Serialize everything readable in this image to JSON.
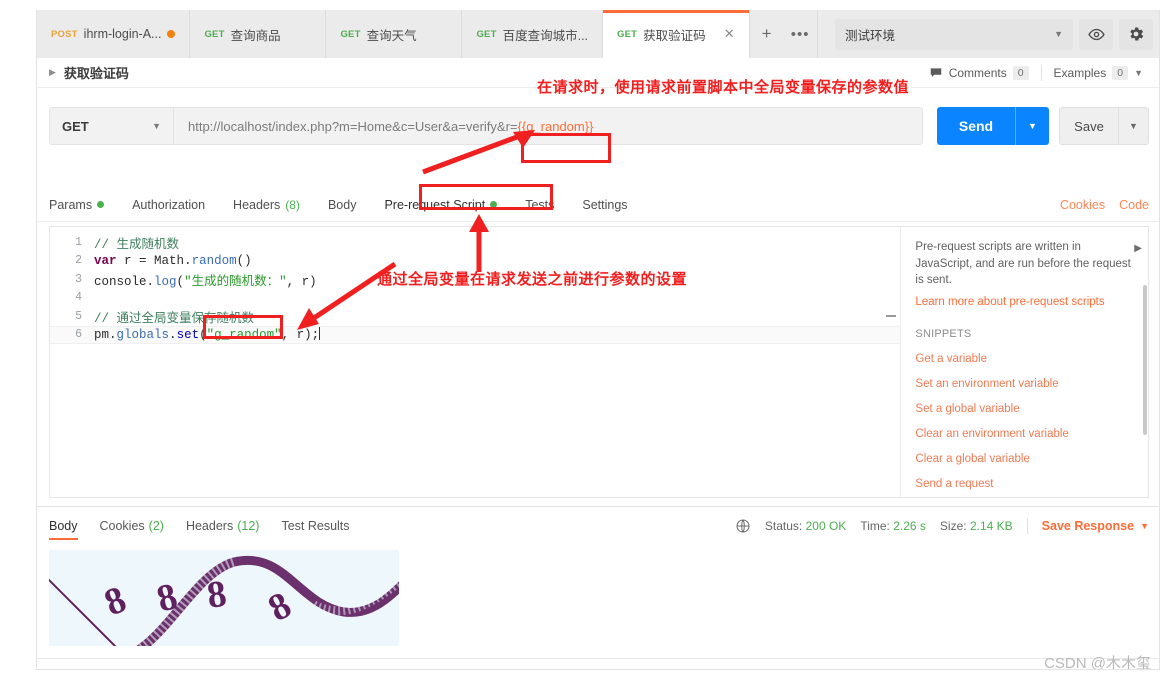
{
  "tabbar": {
    "tabs": [
      {
        "method": "POST",
        "method_class": "post",
        "label": "ihrm-login-A...",
        "unsaved": true,
        "active": false
      },
      {
        "method": "GET",
        "method_class": "get",
        "label": "查询商品",
        "unsaved": false,
        "active": false
      },
      {
        "method": "GET",
        "method_class": "get",
        "label": "查询天气",
        "unsaved": false,
        "active": false
      },
      {
        "method": "GET",
        "method_class": "get",
        "label": "百度查询城市...",
        "unsaved": false,
        "active": false
      },
      {
        "method": "GET",
        "method_class": "get",
        "label": "获取验证码",
        "unsaved": false,
        "active": true
      }
    ],
    "new_tab_label": "+",
    "more_label": "•••",
    "close_label": "✕",
    "environment": "测试环境",
    "env_caret": "▼",
    "eye_icon": "eye-icon",
    "gear_icon": "gear-icon"
  },
  "breadcrumb": {
    "caret": "▶",
    "title": "获取验证码",
    "comments_label": "Comments",
    "comments_count": "0",
    "examples_label": "Examples",
    "examples_count": "0",
    "examples_caret": "▼"
  },
  "request": {
    "method": "GET",
    "method_caret": "▼",
    "url_prefix": "http://localhost/index.php?m=Home&c=User&a=verify&r=",
    "url_variable": "{{g_random}}",
    "url_full": "http://localhost/index.php?m=Home&c=User&a=verify&r={{g_random}}",
    "send_label": "Send",
    "send_caret": "▼",
    "save_label": "Save",
    "save_caret": "▼"
  },
  "request_tabs": {
    "items": [
      {
        "label": "Params",
        "marker": "dot",
        "count": "",
        "active": false
      },
      {
        "label": "Authorization",
        "marker": "",
        "count": "",
        "active": false
      },
      {
        "label": "Headers",
        "marker": "count",
        "count": "(8)",
        "active": false
      },
      {
        "label": "Body",
        "marker": "",
        "count": "",
        "active": false
      },
      {
        "label": "Pre-request Script",
        "marker": "dot",
        "count": "",
        "active": true
      },
      {
        "label": "Tests",
        "marker": "",
        "count": "",
        "active": false
      },
      {
        "label": "Settings",
        "marker": "",
        "count": "",
        "active": false
      }
    ],
    "cookies_label": "Cookies",
    "code_label": "Code"
  },
  "editor": {
    "lines": [
      {
        "num": "1",
        "text": "// 生成随机数"
      },
      {
        "num": "2",
        "text": "var r = Math.random()"
      },
      {
        "num": "3",
        "text": "console.log(\"生成的随机数：\", r)"
      },
      {
        "num": "4",
        "text": ""
      },
      {
        "num": "5",
        "text": "// 通过全局变量保存随机数"
      },
      {
        "num": "6",
        "text": "pm.globals.set(\"g_random\", r);"
      }
    ],
    "line_numbers": [
      "1",
      "2",
      "3",
      "4",
      "5",
      "6"
    ],
    "l1_comment": "// 生成随机数",
    "l2_kw": "var",
    "l2_rest": " r = ",
    "l2_obj": "Math",
    "l2_dot": ".",
    "l2_fn": "random",
    "l2_paren": "()",
    "l3_obj": "console",
    "l3_dot": ".",
    "l3_fn": "log",
    "l3_open": "(",
    "l3_str": "\"生成的随机数：\"",
    "l3_close": ", r)",
    "l5_comment": "// 通过全局变量保存随机数",
    "l6_obj": "pm",
    "l6_dot1": ".",
    "l6_prop": "globals",
    "l6_dot2": ".",
    "l6_fn": "set",
    "l6_open": "(",
    "l6_str": "\"g_random\"",
    "l6_close": ", r);"
  },
  "snippets": {
    "description": "Pre-request scripts are written in JavaScript, and are run before the request is sent.",
    "learn_more": "Learn more about pre-request scripts",
    "heading": "SNIPPETS",
    "collapse_caret": "▶",
    "items": [
      "Get a variable",
      "Set an environment variable",
      "Set a global variable",
      "Clear an environment variable",
      "Clear a global variable",
      "Send a request"
    ]
  },
  "response": {
    "tabs": [
      {
        "label": "Body",
        "count": "",
        "active": true
      },
      {
        "label": "Cookies",
        "count": "(2)",
        "active": false
      },
      {
        "label": "Headers",
        "count": "(12)",
        "active": false
      },
      {
        "label": "Test Results",
        "count": "",
        "active": false
      }
    ],
    "globe_icon": "globe-icon",
    "status_label": "Status:",
    "status_value": "200 OK",
    "time_label": "Time:",
    "time_value": "2.26 s",
    "size_label": "Size:",
    "size_value": "2.14 KB",
    "save_response_label": "Save Response",
    "save_response_caret": "▼",
    "body_image_alt": "captcha-image-8888"
  },
  "annotations": {
    "top_note": "在请求时，使用请求前置脚本中全局变量保存的参数值",
    "mid_note": "通过全局变量在请求发送之前进行参数的设置"
  },
  "watermark": "CSDN @木木玺",
  "colors": {
    "accent_orange": "#ff6c37",
    "send_blue": "#0a84ff",
    "status_green": "#4caf50",
    "annotation_red": "#f02020"
  }
}
